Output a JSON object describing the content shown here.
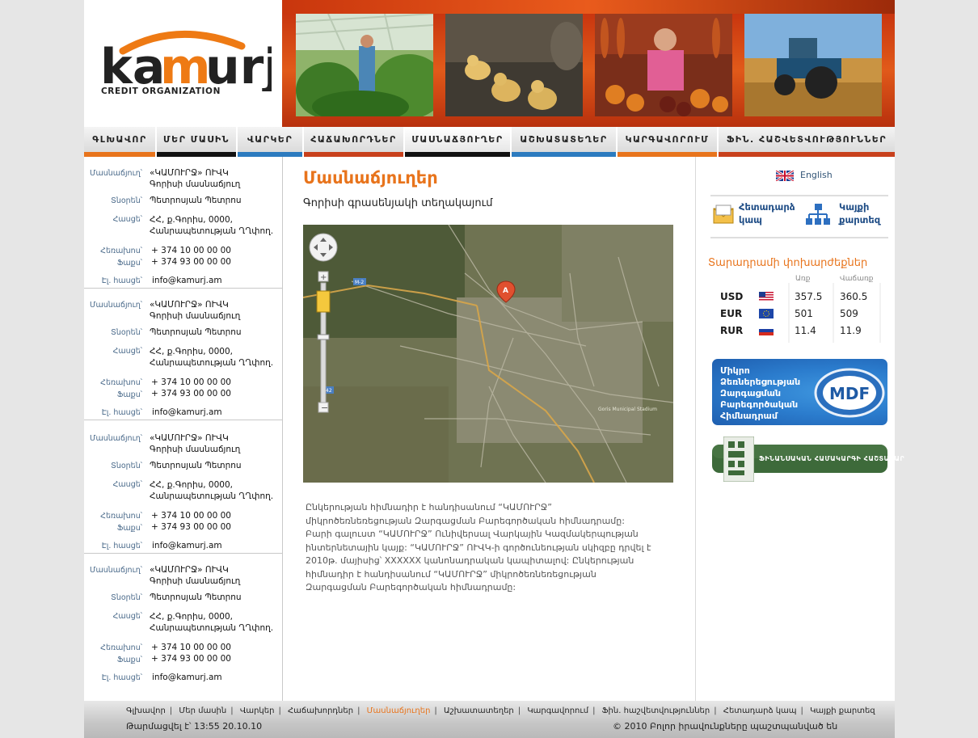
{
  "logo": {
    "name": "kamurj",
    "subtitle": "CREDIT ORGANIZATION"
  },
  "header": {
    "photos": [
      "greenhouse-photo",
      "chicks-photo",
      "market-vendor-photo",
      "tractor-field-photo"
    ]
  },
  "menu": {
    "items": [
      {
        "label": "ԳԼԽԱՎՈՐ",
        "color": "#e8741c"
      },
      {
        "label": "ՄԵՐ ՄԱՍԻՆ",
        "color": "#111111"
      },
      {
        "label": "ՎԱՐԿԵՐ",
        "color": "#2c7bbf"
      },
      {
        "label": "ՀԱՃԱԽՈՐԴՆԵՐ",
        "color": "#c8401c"
      },
      {
        "label": "ՄԱՍՆԱՃՅՈՒՂԵՐ",
        "color": "#111111"
      },
      {
        "label": "ԱՇԽԱՏԱՏԵՂԵՐ",
        "color": "#2c7bbf"
      },
      {
        "label": "ԿԱՐԳԱՎՈՐՈՒՄ",
        "color": "#e8741c"
      },
      {
        "label": "ՖԻՆ. ՀԱՇՎԵՏՎՈՒԹՅՈՒՆՆԵՐ",
        "color": "#c8401c"
      }
    ]
  },
  "labels": {
    "branch": "Մասնաճյուղ՝",
    "director": "Տնօրեն՝",
    "address": "Հասցե՝",
    "phone": "Հեռախոս՝",
    "fax": "Ֆաքս՝",
    "email": "Էլ. հասցե՝"
  },
  "branches": [
    {
      "name_line1": "«ԿԱՄՈՒՐՋ» ՈՒՎԿ",
      "name_line2": "Գորիսի մասնաճյուղ",
      "director": "Պետրոսյան Պետրոս",
      "address_line1": "ՀՀ, ք.Գորիս, 0000,",
      "address_line2": "Հանրապետության ՂՂփող.",
      "phone": "+ 374 10 00 00 00",
      "fax": "+ 374 93 00 00 00",
      "email": "info@kamurj.am"
    },
    {
      "name_line1": "«ԿԱՄՈՒՐՋ» ՈՒՎԿ",
      "name_line2": "Գորիսի մասնաճյուղ",
      "director": "Պետրոսյան Պետրոս",
      "address_line1": "ՀՀ, ք.Գորիս, 0000,",
      "address_line2": "Հանրապետության ՂՂփող.",
      "phone": "+ 374 10 00 00 00",
      "fax": "+ 374 93 00 00 00",
      "email": "info@kamurj.am"
    },
    {
      "name_line1": "«ԿԱՄՈՒՐՋ» ՈՒՎԿ",
      "name_line2": "Գորիսի մասնաճյուղ",
      "director": "Պետրոսյան Պետրոս",
      "address_line1": "ՀՀ, ք.Գորիս, 0000,",
      "address_line2": "Հանրապետության ՂՂփող.",
      "phone": "+ 374 10 00 00 00",
      "fax": "+ 374 93 00 00 00",
      "email": "info@kamurj.am"
    },
    {
      "name_line1": "«ԿԱՄՈՒՐՋ» ՈՒՎԿ",
      "name_line2": "Գորիսի մասնաճյուղ",
      "director": "Պետրոսյան Պետրոս",
      "address_line1": "ՀՀ, ք.Գորիս, 0000,",
      "address_line2": "Հանրապետության ՂՂփող.",
      "phone": "+ 374 10 00 00 00",
      "fax": "+ 374 93 00 00 00",
      "email": "info@kamurj.am"
    }
  ],
  "main": {
    "title": "Մասնաճյուղեր",
    "subtitle": "Գորիսի գրասենյակի տեղակայում",
    "map": {
      "road_labels": [
        "M-2",
        "42"
      ],
      "place_label": "Goris Municipal Stadium",
      "marker": "A"
    },
    "description": "Ընկերության հիմնադիր է հանդիսանում “ԿԱՄՈՒՐՋ” միկրոծեռնեռեցության Զարգացման Բարեգործական հիմնադրամը: Բարի գալուստ “ԿԱՄՈՒՐՋ” Ունիվերսալ Վարկային Կազմակերպության ինտերնետային կայք: “ԿԱՄՈՒՐՋ” ՈՒՎԿ-ի գործունեության սկիզբը դրվել է 2010թ. մայիսից՝ XXXXXX կանոնադրական կապիտալով: Ընկերության հիմնադիր է հանդիսանում “ԿԱՄՈՒՐՋ” միկրոծեռնեռեցության Զարգացման Բարեգործական հիմնադրամը:"
  },
  "sidebar": {
    "language": "English",
    "quick_links": [
      {
        "line1": "Հետադարձ",
        "line2": "կապ",
        "icon": "envelope-icon"
      },
      {
        "line1": "Կայքի",
        "line2": "քարտեզ",
        "icon": "sitemap-icon"
      }
    ],
    "rates": {
      "title": "Տարադրամի փոխարժեքներ",
      "buy_label": "Առք",
      "sell_label": "Վաճառք",
      "rows": [
        {
          "code": "USD",
          "buy": "357.5",
          "sell": "360.5",
          "flag": "us-flag-icon"
        },
        {
          "code": "EUR",
          "buy": "501",
          "sell": "509",
          "flag": "eu-flag-icon"
        },
        {
          "code": "RUR",
          "buy": "11.4",
          "sell": "11.9",
          "flag": "ru-flag-icon"
        }
      ]
    },
    "mdf_banner": {
      "line1": "Միկրո",
      "line2": "Ձեռներեցության",
      "line3": "Զարգացման",
      "line4": "Բարեգործական",
      "line5": "Հիմնադրամ",
      "logo": "MDF"
    },
    "fin_banner": {
      "text": "ՖԻՆԱՆՍԱԿԱՆ ՀԱՄԱԿԱՐԳԻ ՀԱՇՏԱՐԱՐ"
    }
  },
  "footer": {
    "links": [
      "Գլխավոր",
      "Մեր մասին",
      "Վարկեր",
      "Հաճախորդներ",
      "Մասնաճյուղեր",
      "Աշխատատեղեր",
      "Կարգավորում",
      "Ֆին. հաշվետվություններ",
      "Հետադարձ կապ",
      "Կայքի քարտեզ"
    ],
    "active_link": "Մասնաճյուղեր",
    "updated": "Թարմացվել է՝ 13:55  20.10.10",
    "copyright": "© 2010 Բոլոր իրավունքները պաշտպանված են"
  }
}
